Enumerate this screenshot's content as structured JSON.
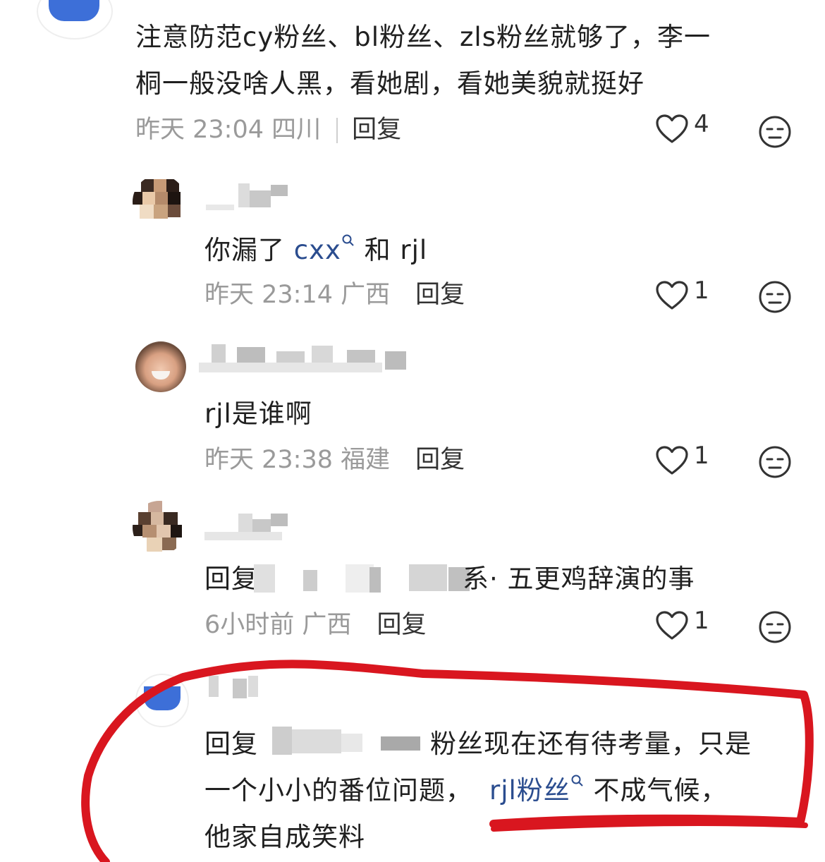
{
  "main_comment": {
    "text_line1": "注意防范cy粉丝、bl粉丝、zls粉丝就够了，李一",
    "text_line2": "桐一般没啥人黑，看她剧，看她美貌就挺好",
    "time": "昨天 23:04",
    "location": "四川",
    "reply_label": "回复",
    "likes": "4"
  },
  "replies": [
    {
      "text_pre": "你漏了 ",
      "link": "cxx",
      "text_post": " 和 rjl",
      "time": "昨天 23:14",
      "location": "广西",
      "reply_label": "回复",
      "likes": "1"
    },
    {
      "text": "rjl是谁啊",
      "time": "昨天 23:38",
      "location": "福建",
      "reply_label": "回复",
      "likes": "1"
    },
    {
      "text_prefix": "回复",
      "text_suffix": "系· 五更鸡辞演的事",
      "time": "6小时前",
      "location": "广西",
      "reply_label": "回复",
      "likes": "1"
    },
    {
      "text_prefix": "回复",
      "text_line1_rest": "粉丝现在还有待考量，只是",
      "text_line2_pre": "一个小小的番位问题，",
      "link": "rjl粉丝",
      "text_line2_post": " 不成气候，",
      "text_line3": "他家自成笑料"
    }
  ],
  "icons": {
    "like": "heart-outline-icon",
    "dislike": "meh-face-icon",
    "search_hint": "search-small-icon"
  },
  "colors": {
    "link": "#2b4d8f",
    "annotation": "#d9161f",
    "meta": "#9a9a9a"
  }
}
